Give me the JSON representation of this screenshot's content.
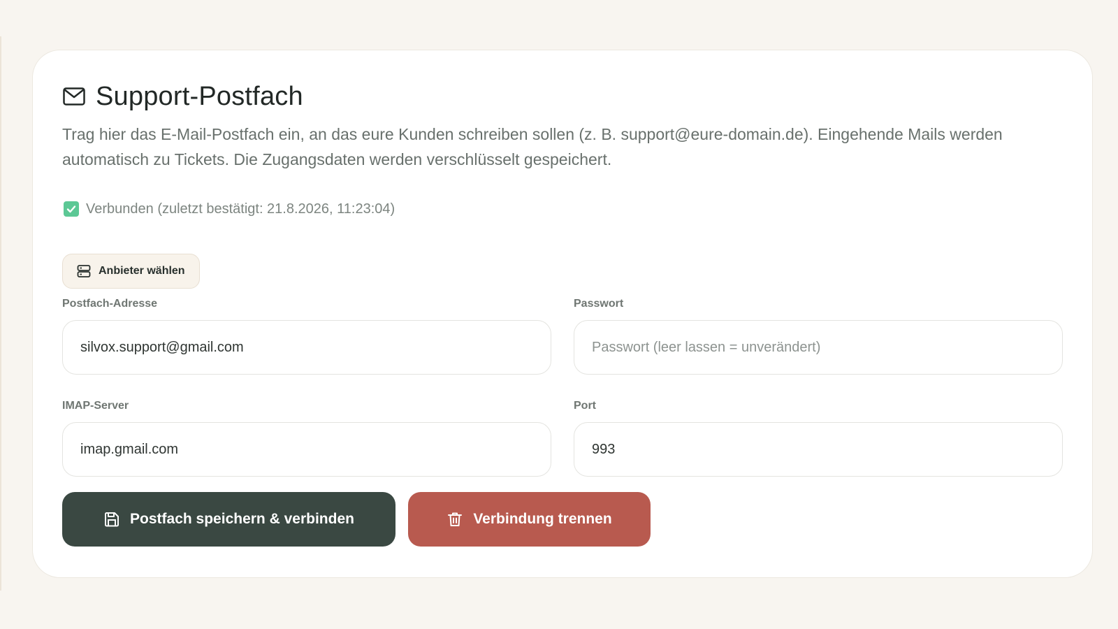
{
  "header": {
    "title": "Support-Postfach",
    "title_icon": "mail-icon",
    "description": "Trag hier das E-Mail-Postfach ein, an das eure Kunden schreiben sollen (z. B. support@eure-domain.de). Eingehende Mails werden automatisch zu Tickets. Die Zugangsdaten werden verschlüsselt gespeichert."
  },
  "status": {
    "text": "Verbunden (zuletzt bestätigt: 21.8.2026, 11:23:04)",
    "icon": "check-icon",
    "color": "#5cc895"
  },
  "provider_button": {
    "label": "Anbieter wählen",
    "icon": "server-icon"
  },
  "fields": {
    "address": {
      "label": "Postfach-Adresse",
      "value": "silvox.support@gmail.com",
      "placeholder": ""
    },
    "password": {
      "label": "Passwort",
      "value": "",
      "placeholder": "Passwort (leer lassen = unverändert)"
    },
    "imap_server": {
      "label": "IMAP-Server",
      "value": "imap.gmail.com",
      "placeholder": ""
    },
    "port": {
      "label": "Port",
      "value": "993",
      "placeholder": ""
    }
  },
  "actions": {
    "save": {
      "label": "Postfach speichern & verbinden",
      "icon": "save-icon",
      "color": "#3a4842"
    },
    "disconnect": {
      "label": "Verbindung trennen",
      "icon": "trash-icon",
      "color": "#b85a4f"
    }
  },
  "colors": {
    "page_background": "#f8f5f0",
    "card_background": "#ffffff",
    "primary_text": "#222826",
    "muted_text": "#68706c"
  }
}
